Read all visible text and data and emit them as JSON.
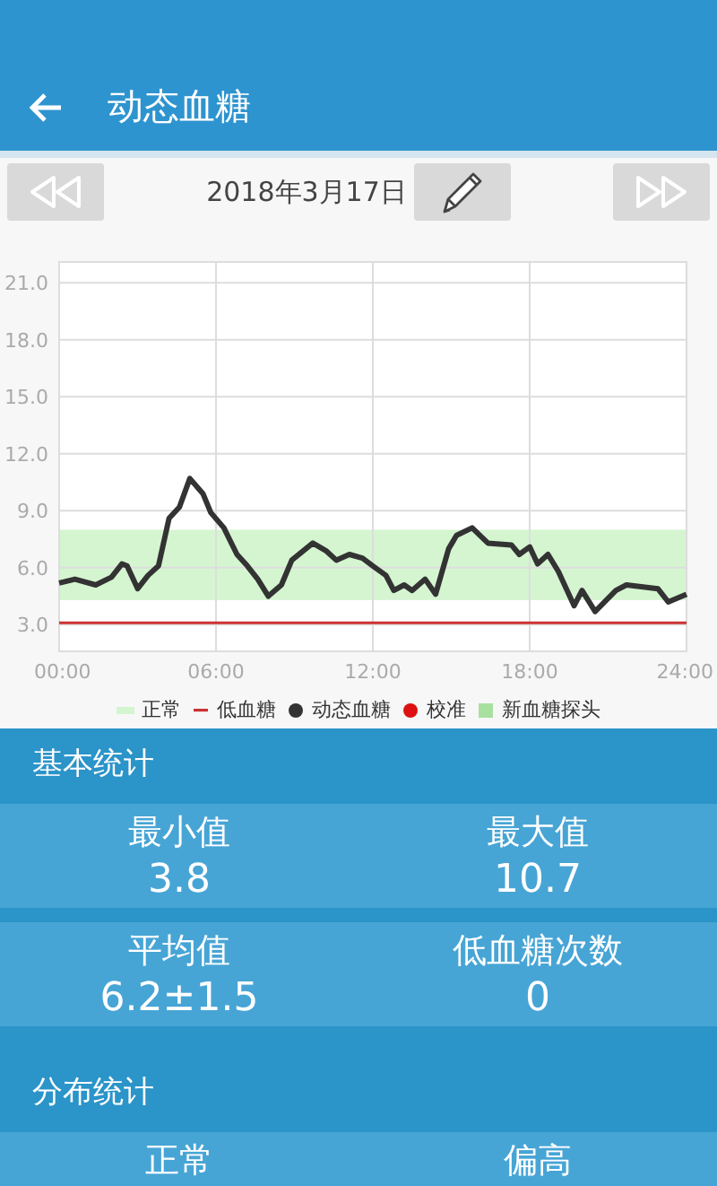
{
  "app_bar": {
    "title": "动态血糖"
  },
  "date_nav": {
    "date": "2018年3月17日"
  },
  "chart": {
    "chart_data": {
      "type": "line",
      "x": [
        0,
        0.6,
        1.4,
        2,
        2.4,
        2.6,
        3,
        3.4,
        3.8,
        4.2,
        4.6,
        5,
        5.5,
        5.8,
        6.3,
        6.8,
        7.2,
        7.6,
        8,
        8.5,
        8.9,
        9.7,
        10.2,
        10.6,
        11.1,
        11.6,
        12,
        12.5,
        12.8,
        13.2,
        13.5,
        14,
        14.4,
        14.9,
        15.2,
        15.8,
        16.4,
        17.3,
        17.6,
        18,
        18.3,
        18.7,
        19.1,
        19.7,
        20,
        20.5,
        21.3,
        21.7,
        22.9,
        23.3,
        24
      ],
      "series": [
        {
          "name": "动态血糖",
          "color": "#333333",
          "values": [
            5.2,
            5.4,
            5.1,
            5.5,
            6.2,
            6.1,
            4.9,
            5.6,
            6.1,
            8.6,
            9.2,
            10.7,
            9.9,
            8.9,
            8.1,
            6.7,
            6.1,
            5.4,
            4.5,
            5.1,
            6.4,
            7.3,
            6.9,
            6.4,
            6.7,
            6.5,
            6.1,
            5.6,
            4.8,
            5.1,
            4.8,
            5.4,
            4.6,
            7.0,
            7.7,
            8.1,
            7.3,
            7.2,
            6.7,
            7.1,
            6.2,
            6.7,
            5.8,
            4.0,
            4.8,
            3.7,
            4.8,
            5.1,
            4.9,
            4.2,
            4.6
          ]
        }
      ],
      "xlim": [
        0,
        24
      ],
      "ylim": [
        1.6,
        22.1
      ],
      "xticks": [
        {
          "value": 0,
          "label": "00:00"
        },
        {
          "value": 6,
          "label": "06:00"
        },
        {
          "value": 12,
          "label": "12:00"
        },
        {
          "value": 18,
          "label": "18:00"
        },
        {
          "value": 24,
          "label": "24:00"
        }
      ],
      "yticks": [
        {
          "value": 3,
          "label": "3.0"
        },
        {
          "value": 6,
          "label": "6.0"
        },
        {
          "value": 9,
          "label": "9.0"
        },
        {
          "value": 12,
          "label": "12.0"
        },
        {
          "value": 15,
          "label": "15.0"
        },
        {
          "value": 18,
          "label": "18.0"
        },
        {
          "value": 21,
          "label": "21.0"
        }
      ],
      "grid": true,
      "bands": [
        {
          "axis": "y",
          "from": 4.3,
          "to": 8.0,
          "color": "#d4f5d0"
        }
      ],
      "ref_lines": [
        {
          "axis": "y",
          "value": 3.1,
          "color": "#cc3333"
        }
      ]
    },
    "legend": [
      {
        "label": "正常",
        "kind": "band",
        "color": "#d4f5d0"
      },
      {
        "label": "低血糖",
        "kind": "dash",
        "color": "#cc3333"
      },
      {
        "kind": "series"
      },
      {
        "label": "校准",
        "kind": "dot",
        "color": "#dd1111"
      },
      {
        "label": "新血糖探头",
        "kind": "square",
        "color": "#a8e0a0"
      }
    ]
  },
  "sections": [
    {
      "title": "基本统计",
      "rows": [
        [
          {
            "label": "最小值",
            "value": "3.8"
          },
          {
            "label": "最大值",
            "value": "10.7"
          }
        ],
        [
          {
            "label": "平均值",
            "value": "6.2±1.5"
          },
          {
            "label": "低血糖次数",
            "value": "0"
          }
        ]
      ]
    },
    {
      "title": "分布统计",
      "rows": [
        [
          {
            "label": "正常"
          },
          {
            "label": "偏高"
          }
        ]
      ]
    }
  ]
}
